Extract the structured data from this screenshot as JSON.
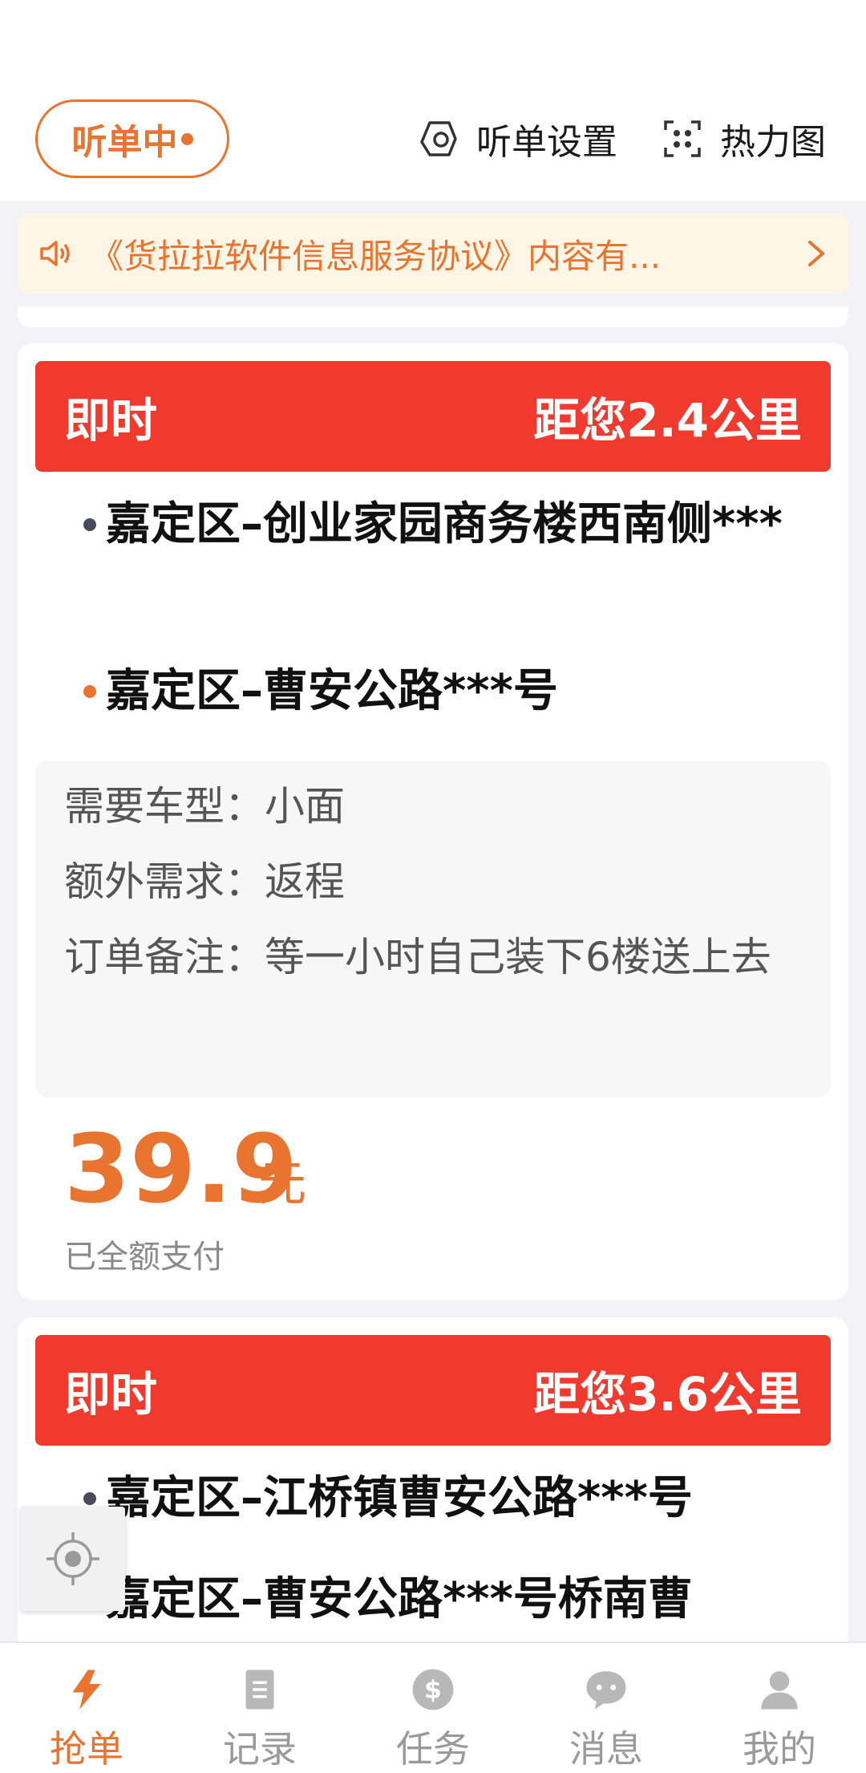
{
  "header": {
    "listening_label": "听单中",
    "order_settings_label": "听单设置",
    "heatmap_label": "热力图"
  },
  "notice": {
    "text": "《货拉拉软件信息服务协议》内容有..."
  },
  "orders": [
    {
      "type": "即时",
      "distance": "距您2.4公里",
      "pickup": "嘉定区–创业家园商务楼西南侧***",
      "dropoff": "嘉定区–曹安公路***号",
      "vehicle": "需要车型：小面",
      "extra": "额外需求：返程",
      "remark": "订单备注：等一小时自己装下6楼送上去",
      "price": "39.9",
      "price_unit": "元",
      "payment_status": "已全额支付"
    },
    {
      "type": "即时",
      "distance": "距您3.6公里",
      "pickup": "嘉定区–江桥镇曹安公路***号",
      "dropoff": "嘉定区–曹安公路***号桥南曹"
    }
  ],
  "tabbar": {
    "items": [
      {
        "label": "抢单",
        "icon": "lightning-icon",
        "active": true
      },
      {
        "label": "记录",
        "icon": "document-icon",
        "active": false
      },
      {
        "label": "任务",
        "icon": "dollar-icon",
        "active": false
      },
      {
        "label": "消息",
        "icon": "chat-bubble-icon",
        "active": false
      },
      {
        "label": "我的",
        "icon": "person-icon",
        "active": false
      }
    ]
  },
  "colors": {
    "accent": "#e8742f",
    "card_header_red": "#f03a2e",
    "notice_bg": "#fdf6e6"
  }
}
